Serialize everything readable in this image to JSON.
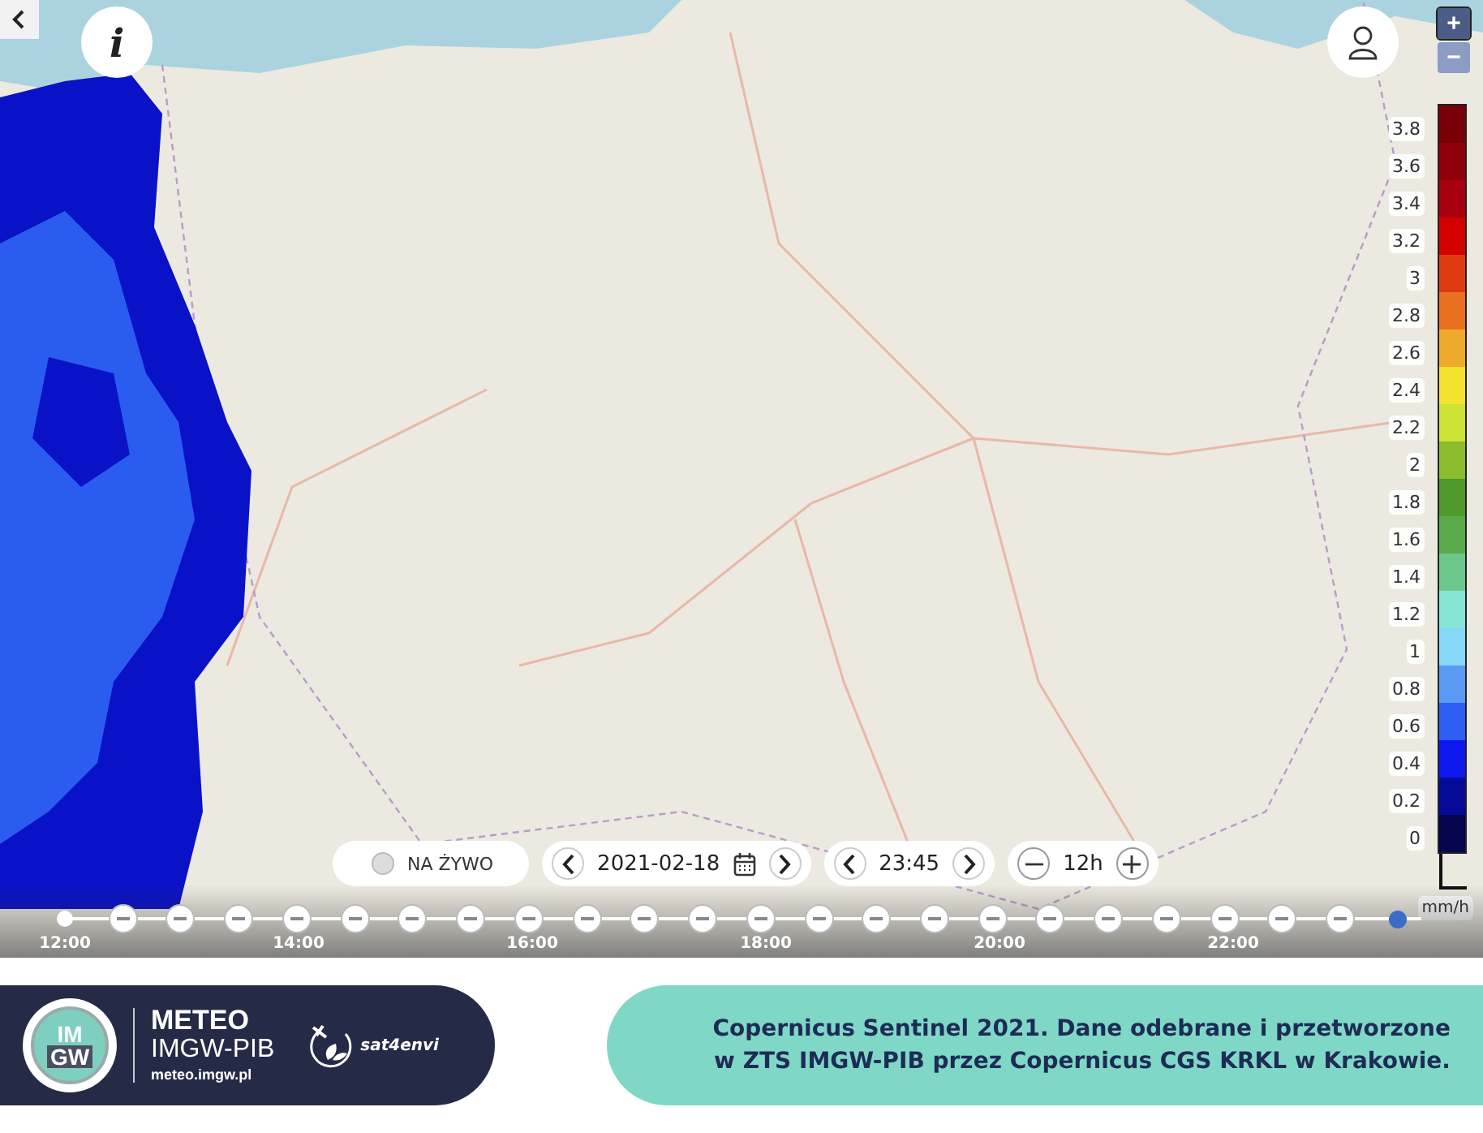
{
  "top_controls": {
    "info": "i",
    "zoom_in": "+",
    "zoom_out": "−"
  },
  "legend": {
    "labels": [
      "3.8",
      "3.6",
      "3.4",
      "3.2",
      "3",
      "2.8",
      "2.6",
      "2.4",
      "2.2",
      "2",
      "1.8",
      "1.6",
      "1.4",
      "1.2",
      "1",
      "0.8",
      "0.6",
      "0.4",
      "0.2",
      "0"
    ],
    "bins": [
      {
        "color": "#7a0008"
      },
      {
        "color": "#8f000b"
      },
      {
        "color": "#a8000e"
      },
      {
        "color": "#d40000"
      },
      {
        "color": "#e03a12"
      },
      {
        "color": "#e8701e"
      },
      {
        "color": "#eeaa2a"
      },
      {
        "color": "#f6e12e"
      },
      {
        "color": "#cce234"
      },
      {
        "color": "#8cbd2e"
      },
      {
        "color": "#4f9a2a"
      },
      {
        "color": "#5aaa4c"
      },
      {
        "color": "#6cc88a"
      },
      {
        "color": "#86e6d6"
      },
      {
        "color": "#86d8f8"
      },
      {
        "color": "#5a9af4"
      },
      {
        "color": "#2e5ef4"
      },
      {
        "color": "#1018f0"
      },
      {
        "color": "#060a98"
      },
      {
        "color": "#04064e"
      }
    ],
    "unit": "mm/h"
  },
  "controls": {
    "live": {
      "label": "NA ŻYWO",
      "selected": false
    },
    "date": "2021-02-18",
    "time": "23:45",
    "period": "12h"
  },
  "timeline": {
    "labels": [
      "12:00",
      "14:00",
      "16:00",
      "18:00",
      "20:00",
      "22:00"
    ],
    "frames": [
      {
        "kind": "start",
        "selected": false
      },
      {
        "kind": "frame",
        "selected": false
      },
      {
        "kind": "frame",
        "selected": false
      },
      {
        "kind": "frame",
        "selected": false
      },
      {
        "kind": "frame",
        "selected": false
      },
      {
        "kind": "frame",
        "selected": false
      },
      {
        "kind": "frame",
        "selected": false
      },
      {
        "kind": "frame",
        "selected": false
      },
      {
        "kind": "frame",
        "selected": false
      },
      {
        "kind": "frame",
        "selected": false
      },
      {
        "kind": "frame",
        "selected": false
      },
      {
        "kind": "frame",
        "selected": false
      },
      {
        "kind": "frame",
        "selected": false
      },
      {
        "kind": "frame",
        "selected": false
      },
      {
        "kind": "frame",
        "selected": false
      },
      {
        "kind": "frame",
        "selected": false
      },
      {
        "kind": "frame",
        "selected": false
      },
      {
        "kind": "frame",
        "selected": false
      },
      {
        "kind": "frame",
        "selected": false
      },
      {
        "kind": "frame",
        "selected": false
      },
      {
        "kind": "frame",
        "selected": false
      },
      {
        "kind": "frame",
        "selected": false
      },
      {
        "kind": "frame",
        "selected": false
      },
      {
        "kind": "frame",
        "selected": true
      }
    ]
  },
  "footer": {
    "logo": {
      "top": "IM",
      "bottom": "GW"
    },
    "brand": "METEO",
    "brand_sub": "IMGW-PIB",
    "url": "meteo.imgw.pl",
    "partner": "sat4envi",
    "caption": [
      "Copernicus Sentinel 2021. Dane odebrane i przetworzone",
      "w ZTS IMGW-PIB przez Copernicus CGS KRKL w Krakowie."
    ]
  }
}
